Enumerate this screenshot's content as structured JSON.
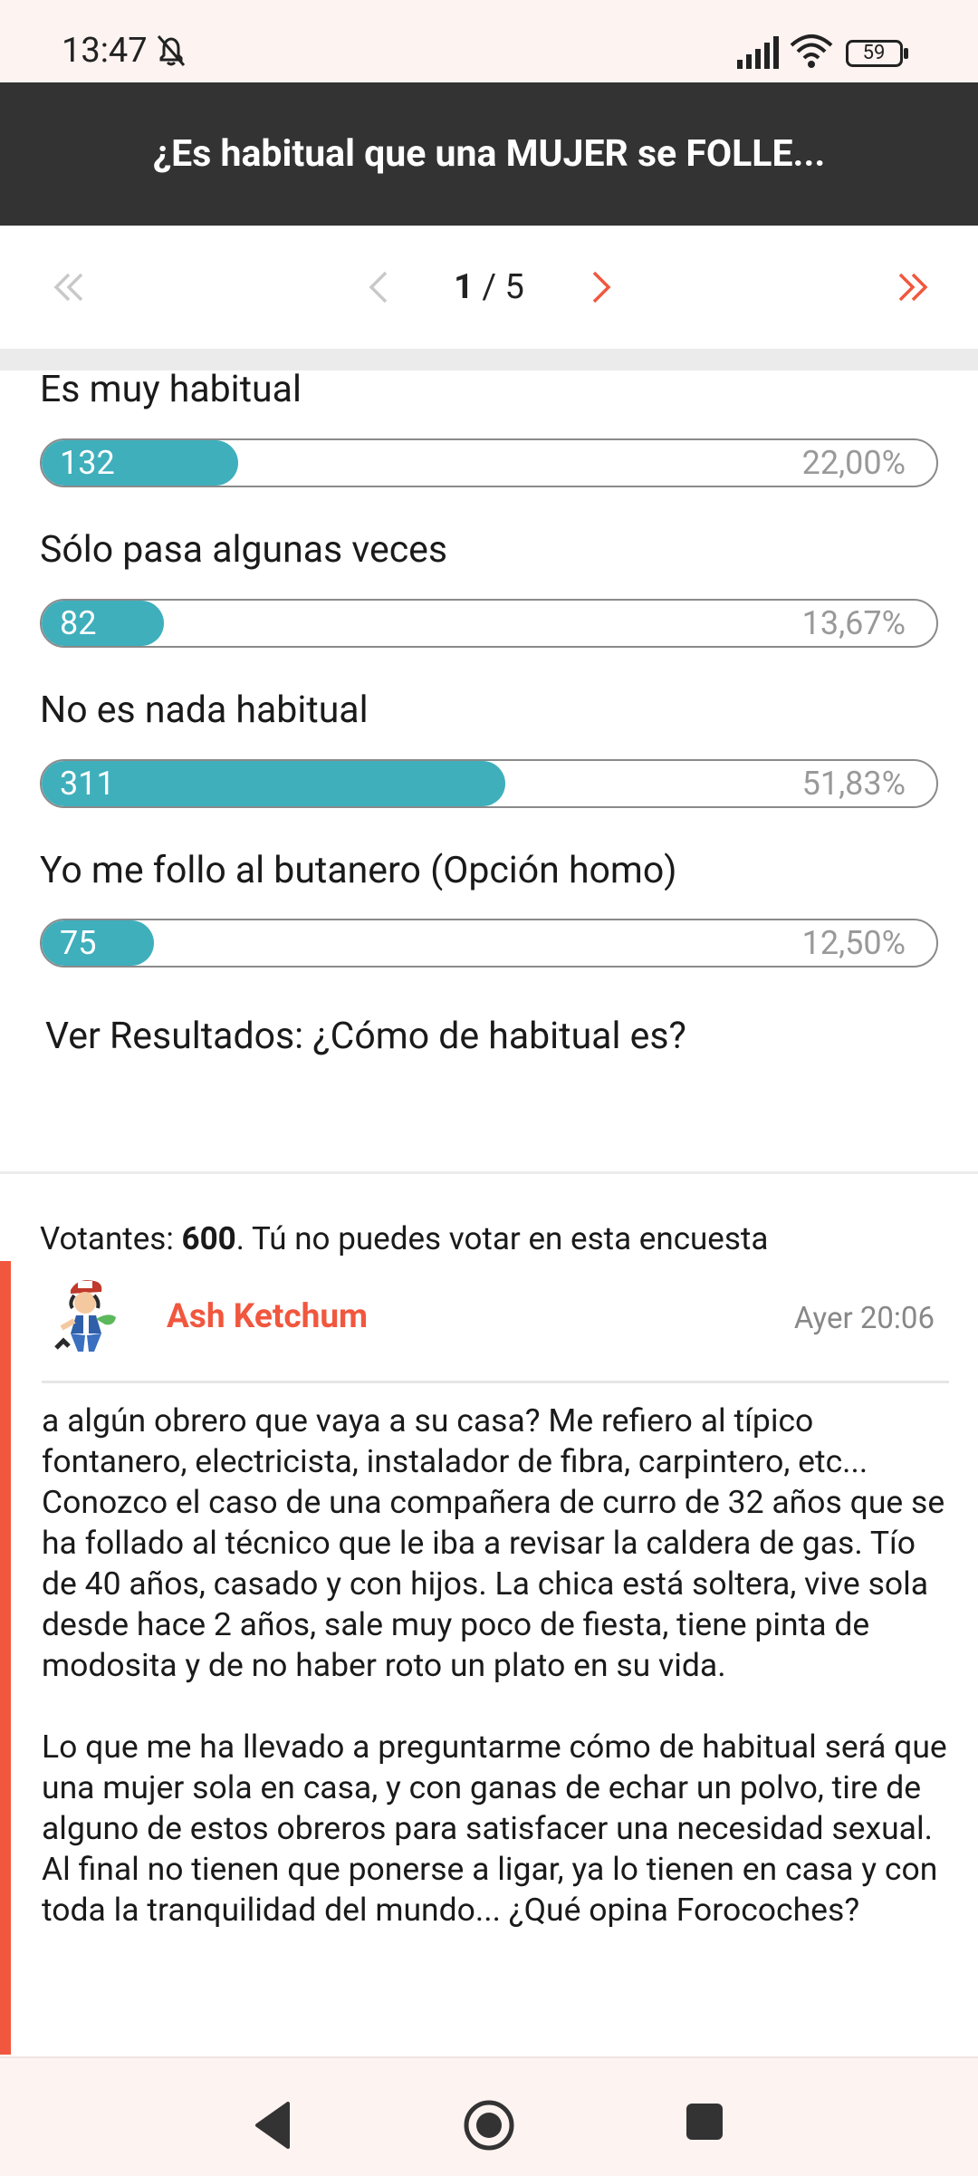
{
  "status_bar": {
    "time": "13:47",
    "battery": "59"
  },
  "header": {
    "title": "¿Es habitual que una MUJER se FOLLE..."
  },
  "pager": {
    "current": "1",
    "separator": " / ",
    "total": "5"
  },
  "poll": {
    "options": [
      {
        "label": "Es muy habitual",
        "votes": "132",
        "percent": "22,00%",
        "fraction": 0.22
      },
      {
        "label": "Sólo pasa algunas veces",
        "votes": "82",
        "percent": "13,67%",
        "fraction": 0.1367
      },
      {
        "label": "No es nada habitual",
        "votes": "311",
        "percent": "51,83%",
        "fraction": 0.5183
      },
      {
        "label": "Yo me follo al butanero (Opción homo)",
        "votes": "75",
        "percent": "12,50%",
        "fraction": 0.125
      }
    ],
    "results_link": "Ver Resultados: ¿Cómo de habitual es?",
    "voters_label": "Votantes: ",
    "voters_count": "600",
    "voters_note": ". Tú no puedes votar en esta encuesta"
  },
  "post": {
    "author": "Ash Ketchum",
    "time": "Ayer 20:06",
    "body": "a algún obrero que vaya a su casa? Me refiero al típico fontanero, electricista, instalador de fibra, carpintero, etc... Conozco el caso de una compañera de curro de 32 años que se ha follado al técnico que le iba a revisar la caldera de gas. Tío de 40 años, casado y con hijos. La chica está soltera, vive sola desde hace 2 años, sale muy poco de fiesta, tiene pinta de modosita y de no haber roto un plato en su vida.\n\nLo que me ha llevado a preguntarme cómo de habitual será que una mujer sola en casa, y con ganas de echar un polvo, tire de alguno de estos obreros para satisfacer una necesidad sexual. Al final no tienen que ponerse a ligar, ya lo tienen en casa y con toda la tranquilidad del mundo... ¿Qué opina Forocoches?"
  },
  "colors": {
    "accent": "#f1573e",
    "bar_fill": "#3fafbc",
    "header_bg": "#333333"
  }
}
